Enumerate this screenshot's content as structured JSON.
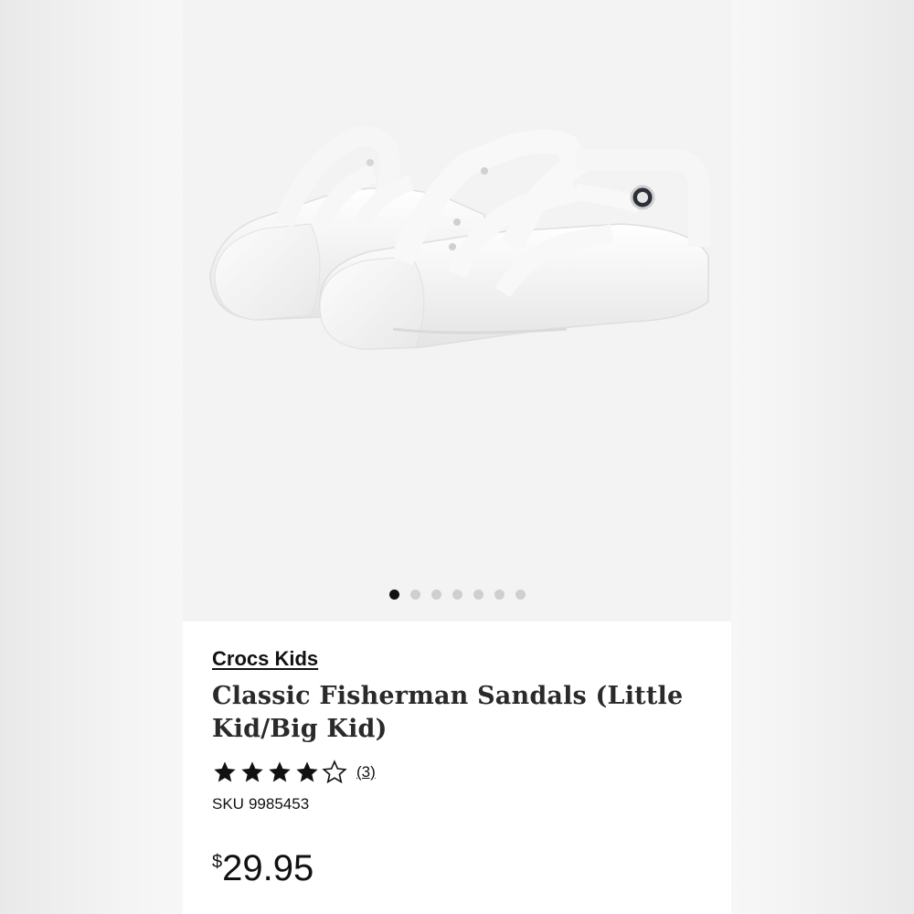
{
  "gallery": {
    "image_subject": "white-fisherman-sandals",
    "dots_total": 7,
    "active_dot_index": 0
  },
  "product": {
    "brand": "Crocs Kids",
    "title_line1": "Classic Fisherman Sandals (Little",
    "title_line2": "Kid/Big Kid)",
    "rating": 4,
    "rating_max": 5,
    "review_count": "(3)",
    "sku_label": "SKU",
    "sku_value": "9985453",
    "price_currency": "$",
    "price_amount": "29.95"
  },
  "colors": {
    "star_fill": "#111111",
    "dot_active": "#111111",
    "dot_inactive": "#cfcfcf"
  }
}
